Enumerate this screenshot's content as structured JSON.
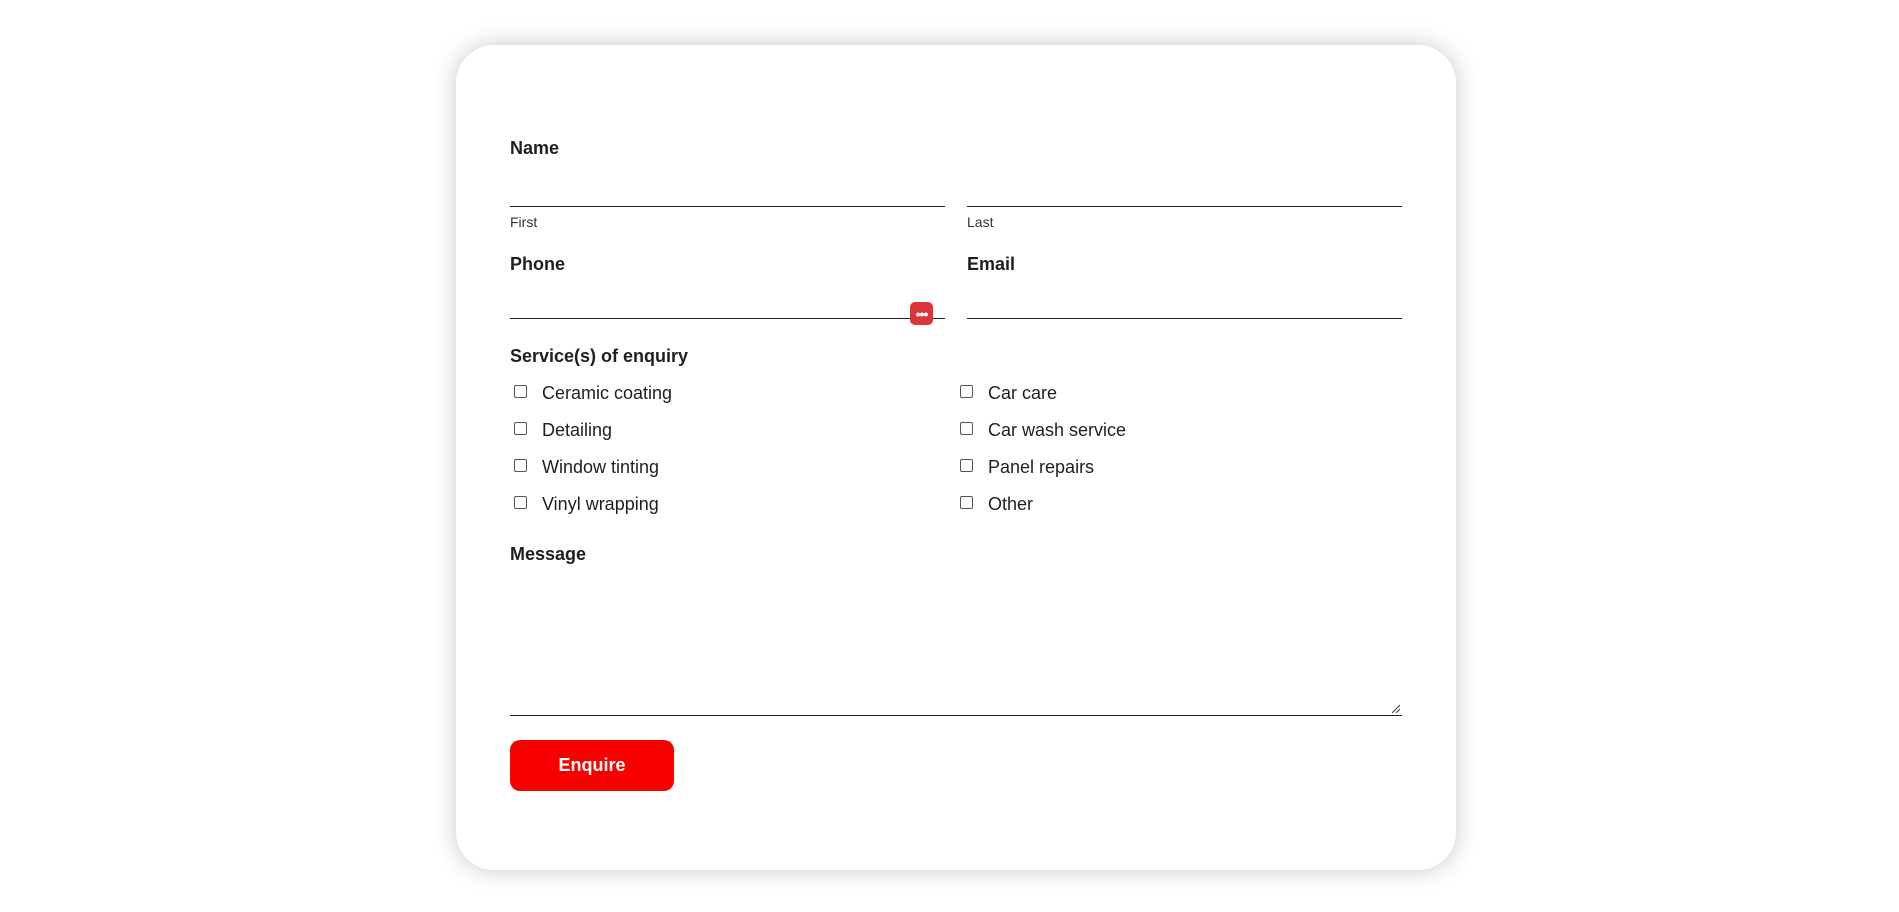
{
  "form": {
    "name": {
      "label": "Name",
      "first_sublabel": "First",
      "last_sublabel": "Last",
      "first_value": "",
      "last_value": ""
    },
    "phone": {
      "label": "Phone",
      "value": "",
      "autofill_icon": "password-manager-icon"
    },
    "email": {
      "label": "Email",
      "value": ""
    },
    "services": {
      "label": "Service(s) of enquiry",
      "left": [
        {
          "label": "Ceramic coating",
          "checked": false
        },
        {
          "label": "Detailing",
          "checked": false
        },
        {
          "label": "Window tinting",
          "checked": false
        },
        {
          "label": "Vinyl wrapping",
          "checked": false
        }
      ],
      "right": [
        {
          "label": "Car care",
          "checked": false
        },
        {
          "label": "Car wash service",
          "checked": false
        },
        {
          "label": "Panel repairs",
          "checked": false
        },
        {
          "label": "Other",
          "checked": false
        }
      ]
    },
    "message": {
      "label": "Message",
      "value": ""
    },
    "submit_label": "Enquire"
  },
  "colors": {
    "accent": "#f60000",
    "autofill_icon_bg": "#d9353b",
    "text": "#1f1f1f"
  }
}
